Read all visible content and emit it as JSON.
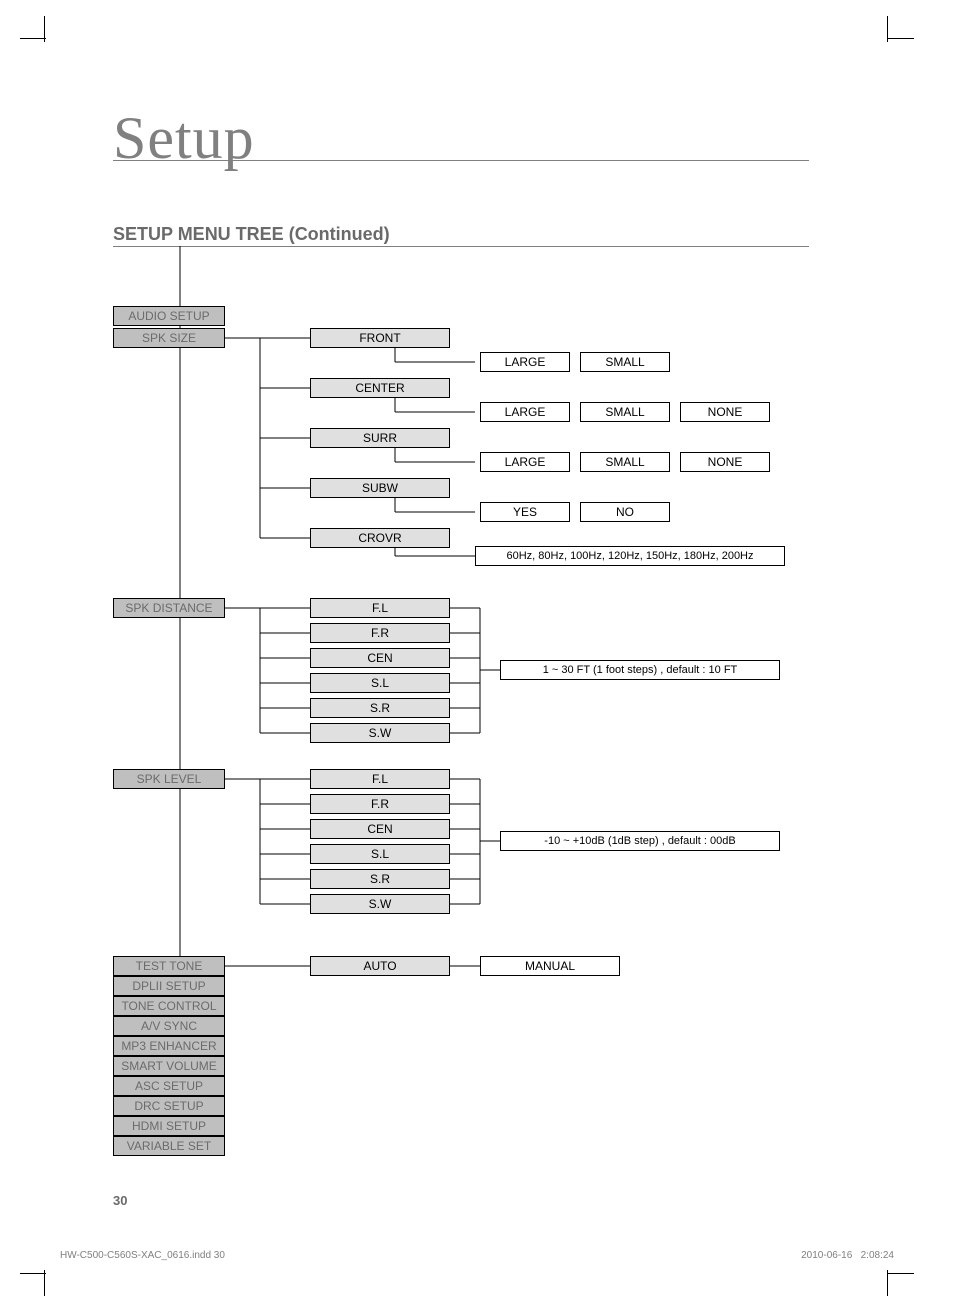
{
  "title": "Setup",
  "subtitle": "SETUP MENU TREE (Continued)",
  "page_number": "30",
  "footer_left": "HW-C500-C560S-XAC_0616.indd   30",
  "footer_date": "2010-06-16",
  "footer_time": "2:08:24",
  "sidebar": {
    "audio_setup": "AUDIO SETUP",
    "spk_size": "SPK SIZE",
    "spk_distance": "SPK DISTANCE",
    "spk_level": "SPK LEVEL",
    "test_tone": "TEST TONE",
    "dplii_setup": "DPLII SETUP",
    "tone_control": "TONE CONTROL",
    "av_sync": "A/V SYNC",
    "mp3_enhancer": "MP3 ENHANCER",
    "smart_volume": "SMART VOLUME",
    "asc_setup": "ASC SETUP",
    "drc_setup": "DRC SETUP",
    "hdmi_setup": "HDMI SETUP",
    "variable_set": "VARIABLE SET"
  },
  "spk_size": {
    "front": "FRONT",
    "center": "CENTER",
    "surr": "SURR",
    "subw": "SUBW",
    "crovr": "CROVR",
    "large": "LARGE",
    "small": "SMALL",
    "none": "NONE",
    "yes": "YES",
    "no": "NO",
    "crovr_opts": "60Hz, 80Hz, 100Hz, 120Hz, 150Hz, 180Hz, 200Hz"
  },
  "channels": {
    "fl": "F.L",
    "fr": "F.R",
    "cen": "CEN",
    "sl": "S.L",
    "sr": "S.R",
    "sw": "S.W"
  },
  "spk_distance_range": "1 ~ 30 FT (1 foot steps) , default : 10 FT",
  "spk_level_range": "-10 ~ +10dB (1dB step) , default : 00dB",
  "test_tone": {
    "auto": "AUTO",
    "manual": "MANUAL"
  },
  "chart_data": {
    "type": "tree",
    "root": "AUDIO SETUP",
    "children": [
      {
        "label": "SPK SIZE",
        "children": [
          {
            "label": "FRONT",
            "options": [
              "LARGE",
              "SMALL"
            ]
          },
          {
            "label": "CENTER",
            "options": [
              "LARGE",
              "SMALL",
              "NONE"
            ]
          },
          {
            "label": "SURR",
            "options": [
              "LARGE",
              "SMALL",
              "NONE"
            ]
          },
          {
            "label": "SUBW",
            "options": [
              "YES",
              "NO"
            ]
          },
          {
            "label": "CROVR",
            "options": [
              "60Hz",
              "80Hz",
              "100Hz",
              "120Hz",
              "150Hz",
              "180Hz",
              "200Hz"
            ]
          }
        ]
      },
      {
        "label": "SPK DISTANCE",
        "children": [
          {
            "label": "F.L"
          },
          {
            "label": "F.R"
          },
          {
            "label": "CEN"
          },
          {
            "label": "S.L"
          },
          {
            "label": "S.R"
          },
          {
            "label": "S.W"
          }
        ],
        "range": "1 ~ 30 FT (1 foot steps), default : 10 FT"
      },
      {
        "label": "SPK LEVEL",
        "children": [
          {
            "label": "F.L"
          },
          {
            "label": "F.R"
          },
          {
            "label": "CEN"
          },
          {
            "label": "S.L"
          },
          {
            "label": "S.R"
          },
          {
            "label": "S.W"
          }
        ],
        "range": "-10 ~ +10dB (1dB step), default : 00dB"
      },
      {
        "label": "TEST TONE",
        "options": [
          "AUTO",
          "MANUAL"
        ]
      },
      {
        "label": "DPLII SETUP"
      },
      {
        "label": "TONE CONTROL"
      },
      {
        "label": "A/V SYNC"
      },
      {
        "label": "MP3 ENHANCER"
      },
      {
        "label": "SMART VOLUME"
      },
      {
        "label": "ASC SETUP"
      },
      {
        "label": "DRC SETUP"
      },
      {
        "label": "HDMI SETUP"
      },
      {
        "label": "VARIABLE SET"
      }
    ]
  }
}
